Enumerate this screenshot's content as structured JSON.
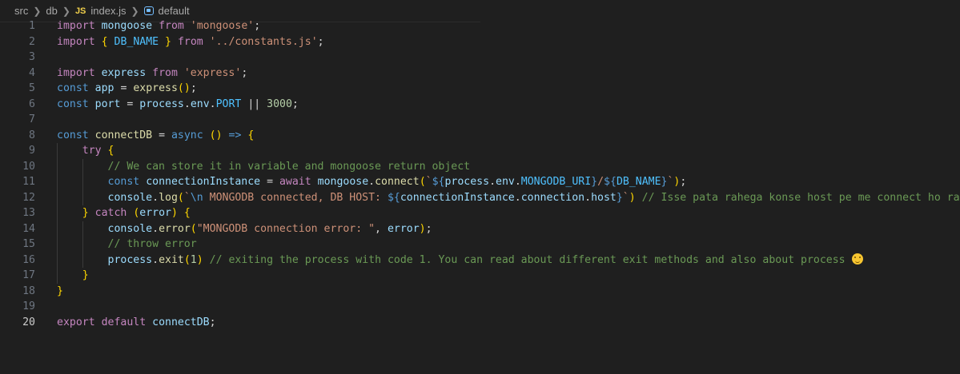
{
  "breadcrumb": {
    "items": [
      "src",
      "db",
      "index.js",
      "default"
    ],
    "file_badge": "JS",
    "symbol_icon": "variable-symbol-icon"
  },
  "editor": {
    "language": "javascript",
    "active_line": 20,
    "lines": [
      {
        "n": "1",
        "text": "import mongoose from 'mongoose';"
      },
      {
        "n": "2",
        "text": "import { DB_NAME } from '../constants.js';"
      },
      {
        "n": "3",
        "text": ""
      },
      {
        "n": "4",
        "text": "import express from 'express';"
      },
      {
        "n": "5",
        "text": "const app = express();"
      },
      {
        "n": "6",
        "text": "const port = process.env.PORT || 3000;"
      },
      {
        "n": "7",
        "text": ""
      },
      {
        "n": "8",
        "text": "const connectDB = async () => {"
      },
      {
        "n": "9",
        "text": "    try {"
      },
      {
        "n": "10",
        "text": "        // We can store it in variable and mongoose return object"
      },
      {
        "n": "11",
        "text": "        const connectionInstance = await mongoose.connect(`${process.env.MONGODB_URI}/${DB_NAME}`);"
      },
      {
        "n": "12",
        "text": "        console.log(`\\n MONGODB connected, DB HOST: ${connectionInstance.connection.host}`) // Isse pata rahega konse host pe me connect ho rah"
      },
      {
        "n": "13",
        "text": "    } catch (error) {"
      },
      {
        "n": "14",
        "text": "        console.error(\"MONGODB connection error: \", error);"
      },
      {
        "n": "15",
        "text": "        // throw error"
      },
      {
        "n": "16",
        "text": "        process.exit(1) // exiting the process with code 1. You can read about different exit methods and also about process 😊"
      },
      {
        "n": "17",
        "text": "    }"
      },
      {
        "n": "18",
        "text": "}"
      },
      {
        "n": "19",
        "text": ""
      },
      {
        "n": "20",
        "text": "export default connectDB;"
      }
    ]
  }
}
